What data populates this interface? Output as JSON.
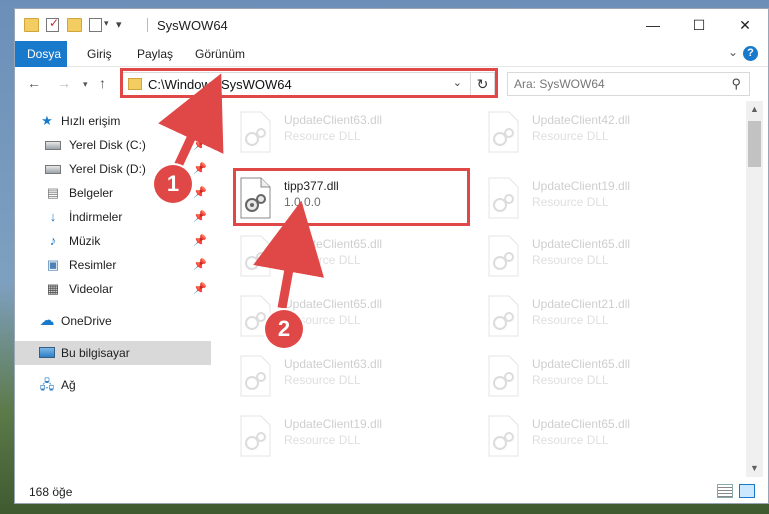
{
  "window": {
    "title": "SysWOW64",
    "controls": {
      "minimize": "—",
      "maximize": "☐",
      "close": "✕"
    }
  },
  "ribbon": {
    "tabs": [
      {
        "label": "Dosya",
        "active": true
      },
      {
        "label": "Giriş"
      },
      {
        "label": "Paylaş"
      },
      {
        "label": "Görünüm"
      }
    ],
    "help": "?"
  },
  "address": {
    "path": "C:\\Windows\\SysWOW64",
    "search_placeholder": "Ara: SysWOW64"
  },
  "nav": {
    "quick_access": "Hızlı erişim",
    "items": [
      {
        "label": "Yerel Disk (C:)",
        "icon": "drive-icon",
        "pinned": true
      },
      {
        "label": "Yerel Disk (D:)",
        "icon": "drive-icon",
        "pinned": true
      },
      {
        "label": "Belgeler",
        "icon": "documents-icon",
        "pinned": true
      },
      {
        "label": "İndirmeler",
        "icon": "download-icon",
        "pinned": true
      },
      {
        "label": "Müzik",
        "icon": "music-icon",
        "pinned": true
      },
      {
        "label": "Resimler",
        "icon": "pictures-icon",
        "pinned": true
      },
      {
        "label": "Videolar",
        "icon": "video-icon",
        "pinned": true
      }
    ],
    "onedrive": "OneDrive",
    "this_pc": "Bu bilgisayar",
    "network": "Ağ"
  },
  "files": {
    "left_column": [
      {
        "name": "UpdateClient63.dll",
        "type": "Resource DLL"
      },
      {
        "name": "tipp377.dll",
        "type": "1.0.0.0",
        "highlighted": true
      },
      {
        "name": "UpdateClient65.dll",
        "type": "Resource DLL"
      },
      {
        "name": "UpdateClient65.dll",
        "type": "Resource DLL"
      },
      {
        "name": "UpdateClient63.dll",
        "type": "Resource DLL"
      },
      {
        "name": "UpdateClient19.dll",
        "type": "Resource DLL"
      }
    ],
    "right_column": [
      {
        "name": "UpdateClient42.dll",
        "type": "Resource DLL"
      },
      {
        "name": "UpdateClient19.dll",
        "type": "Resource DLL"
      },
      {
        "name": "UpdateClient65.dll",
        "type": "Resource DLL"
      },
      {
        "name": "UpdateClient21.dll",
        "type": "Resource DLL"
      },
      {
        "name": "UpdateClient65.dll",
        "type": "Resource DLL"
      },
      {
        "name": "UpdateClient65.dll",
        "type": "Resource DLL"
      }
    ]
  },
  "status": {
    "item_count": "168 öğe"
  },
  "annotations": {
    "step1": "1",
    "step2": "2",
    "color": "#e04848"
  }
}
